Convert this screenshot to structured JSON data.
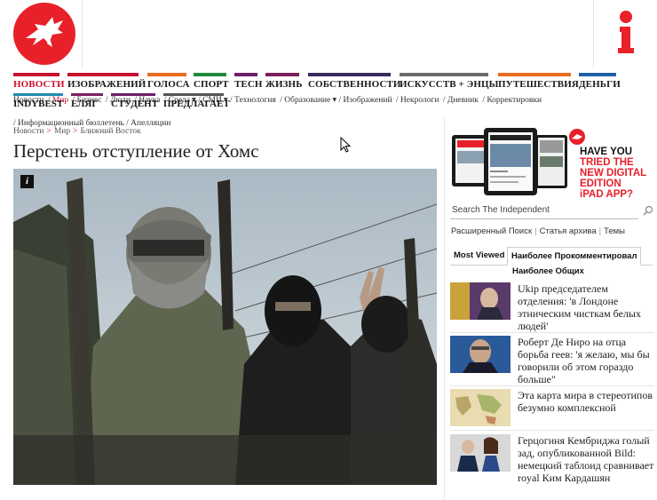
{
  "nav": {
    "items": [
      {
        "label": "НОВОСТИ",
        "color": "#c8102e",
        "active": true
      },
      {
        "label": "ИЗОБРАЖЕНИЙ",
        "color": "#c8102e"
      },
      {
        "label": "ГОЛОСА",
        "color": "#e86b1f"
      },
      {
        "label": "СПОРТ",
        "color": "#1f8a3c"
      },
      {
        "label": "TECH",
        "color": "#6b1f6b"
      },
      {
        "label": "ЖИЗНЬ",
        "color": "#7a1f5e"
      },
      {
        "label": "СОБСТВЕННОСТИ",
        "color": "#3a2a5e"
      },
      {
        "label": "ИСКУССТВ + ЭНЦЫ",
        "color": "#6b6b6b"
      },
      {
        "label": "ПУТЕШЕСТВИЯ",
        "color": "#e86b1f"
      },
      {
        "label": "ДЕНЬГИ",
        "color": "#1f5ea8"
      }
    ],
    "row2": [
      {
        "label": "INDYBEST",
        "color": "#1f8ab0"
      },
      {
        "label": "ЕЛЯГ",
        "color": "#7a1f5e"
      },
      {
        "label": "СТУДЕНТ",
        "color": "#6b1f6b"
      },
      {
        "label": "ПРЕДЛАГАЕТ",
        "color": "#555555"
      }
    ]
  },
  "subnav": {
    "items": [
      "Новости",
      "Мир",
      "Бизнес",
      "Люди",
      "Наука",
      "Среда",
      "СМИ",
      "Технология",
      "Образование",
      "Изображений",
      "Некрологи",
      "Дневник",
      "Корректировки"
    ],
    "row2": [
      "Информационный бюллетень",
      "Апелляции"
    ]
  },
  "breadcrumb": [
    "Новости",
    "Мир",
    "Ближний Восток"
  ],
  "article": {
    "headline": "Перстень отступление от Хомс",
    "photo_badge": "i"
  },
  "ad": {
    "line1": "HAVE YOU",
    "line2": "TRIED THE",
    "line3": "NEW DIGITAL",
    "line4": "EDITION",
    "line5": "iPAD APP?"
  },
  "search": {
    "placeholder": "Search The Independent",
    "links": [
      "Расширенный Поиск",
      "Статья архива",
      "Темы"
    ]
  },
  "tabs": {
    "items": [
      "Most Viewed",
      "Наиболее Прокомментировал"
    ],
    "sub": "Наиболее Общих"
  },
  "stories": [
    {
      "text": "Ukip председателем отделения: 'в Лондоне этническим чисткам белых людей'"
    },
    {
      "text": "Роберт Де Ниро на отца борьба геев: 'я желаю, мы бы говорили об этом гораздо больше\""
    },
    {
      "text": "Эта карта мира в стереотипов безумно комплексной"
    },
    {
      "text": "Герцогиня Кембриджа голый зад, опубликованной Bild: немецкий таблоид сравнивает royal Ким Кардашян"
    }
  ],
  "colors": {
    "brand_red": "#e8202a",
    "link_red": "#c8102e"
  }
}
